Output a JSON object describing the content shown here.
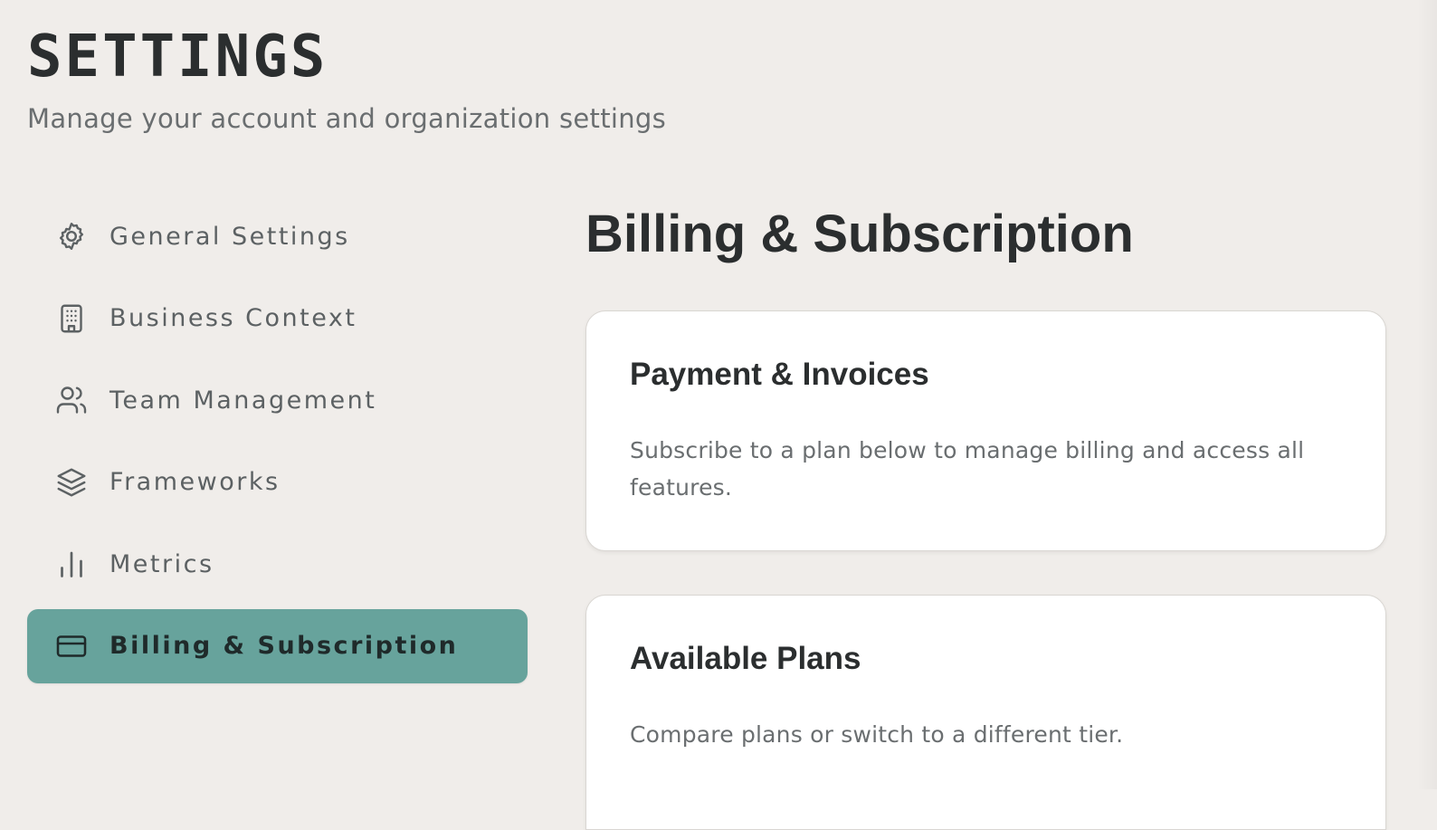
{
  "header": {
    "title": "SETTINGS",
    "subtitle": "Manage your account and organization settings"
  },
  "sidebar": {
    "items": [
      {
        "label": "General Settings",
        "icon": "gear-icon",
        "active": false
      },
      {
        "label": "Business Context",
        "icon": "building-icon",
        "active": false
      },
      {
        "label": "Team Management",
        "icon": "users-icon",
        "active": false
      },
      {
        "label": "Frameworks",
        "icon": "layers-icon",
        "active": false
      },
      {
        "label": "Metrics",
        "icon": "bar-chart-icon",
        "active": false
      },
      {
        "label": "Billing & Subscription",
        "icon": "credit-card-icon",
        "active": true
      }
    ]
  },
  "main": {
    "title": "Billing & Subscription",
    "cards": [
      {
        "title": "Payment & Invoices",
        "description": "Subscribe to a plan below to manage billing and access all features."
      },
      {
        "title": "Available Plans",
        "description": "Compare plans or switch to a different tier."
      }
    ]
  },
  "colors": {
    "background": "#f0edea",
    "accent": "#67a39c",
    "text": "#2b2e2f",
    "muted_text": "#6a6e70",
    "card_background": "#ffffff"
  }
}
